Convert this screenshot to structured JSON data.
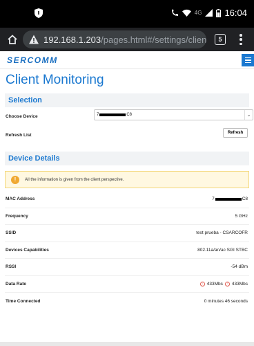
{
  "status_bar": {
    "time": "16:04",
    "network": "4G",
    "icons": [
      "shield-icon",
      "wifi-calling-icon",
      "wifi-icon",
      "signal-icon",
      "battery-icon"
    ]
  },
  "browser": {
    "url_host": "192.168.1.203",
    "url_path": "/pages.html#/settings/client_monitoring",
    "tab_count": "5",
    "icons": [
      "home-icon",
      "warning-icon",
      "tabs-icon",
      "overflow-menu-icon"
    ]
  },
  "app": {
    "logo": "SERCOMM",
    "page_title": "Client Monitoring"
  },
  "selection": {
    "header": "Selection",
    "choose_device_label": "Choose Device",
    "device_prefix": "7",
    "device_suffix": "C8",
    "refresh_list_label": "Refresh List",
    "refresh_button": "Refresh"
  },
  "device_details": {
    "header": "Device Details",
    "info": "All the information is given from the client perspective.",
    "rows": {
      "mac": {
        "label": "MAC Address",
        "prefix": "7",
        "suffix": "C8"
      },
      "frequency": {
        "label": "Frequency",
        "value": "5 GHz"
      },
      "ssid": {
        "label": "SSID",
        "value": "test prueba - CSARCOFR"
      },
      "capabilities": {
        "label": "Devices Capabilities",
        "value": "802.11a/an/ac SGI STBC"
      },
      "rssi": {
        "label": "RSSI",
        "value": "-54 dBm"
      },
      "data_rate": {
        "label": "Data Rate",
        "down": "433Mbs",
        "up": "433Mbs"
      },
      "time_connected": {
        "label": "Time Connected",
        "value": "0 minutes 46 seconds"
      }
    }
  },
  "colors": {
    "brand": "#1a78d0",
    "section_bg": "#f1f3f5",
    "info_bg": "#fff8e1",
    "info_icon": "#f0a830",
    "rate_icon": "#e05a4e"
  }
}
